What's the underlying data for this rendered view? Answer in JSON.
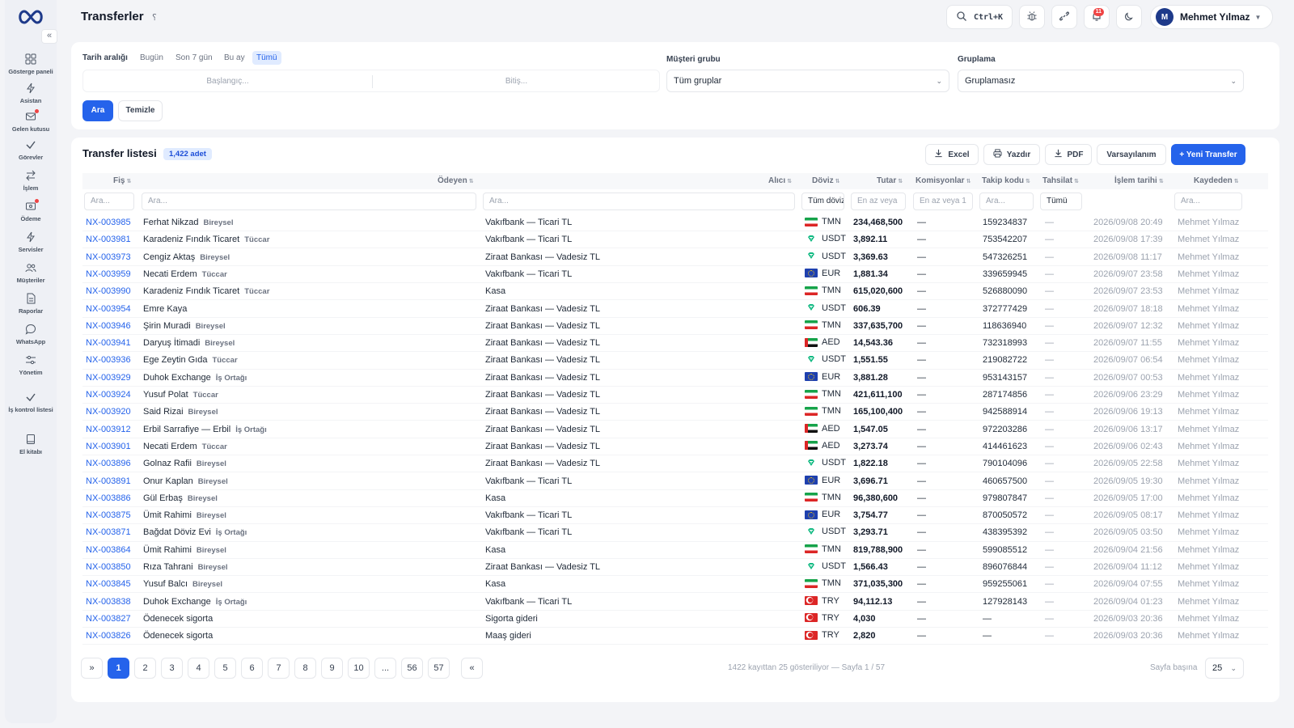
{
  "page": {
    "title": "Transferler"
  },
  "topbar": {
    "search_shortcut": "Ctrl+K",
    "notification_count": "11",
    "user_initial": "M",
    "user_name": "Mehmet Yılmaz"
  },
  "sidebar": {
    "items": [
      {
        "label": "Gösterge paneli"
      },
      {
        "label": "Asistan"
      },
      {
        "label": "Gelen kutusu"
      },
      {
        "label": "Görevler"
      },
      {
        "label": "İşlem"
      },
      {
        "label": "Ödeme"
      },
      {
        "label": "Servisler"
      },
      {
        "label": "Müşteriler"
      },
      {
        "label": "Raporlar"
      },
      {
        "label": "WhatsApp"
      },
      {
        "label": "Yönetim"
      },
      {
        "label": "İş kontrol listesi"
      },
      {
        "label": "El kitabı"
      }
    ]
  },
  "filters": {
    "date_label": "Tarih aralığı",
    "chips": [
      "Bugün",
      "Son 7 gün",
      "Bu ay",
      "Tümü"
    ],
    "start_placeholder": "Başlangıç...",
    "end_placeholder": "Bitiş...",
    "group_label": "Müşteri grubu",
    "group_value": "Tüm gruplar",
    "grouping_label": "Gruplama",
    "grouping_value": "Gruplamasız",
    "search_button": "Ara",
    "clear_button": "Temizle"
  },
  "list": {
    "title": "Transfer listesi",
    "count": "1,422 adet",
    "actions": {
      "excel": "Excel",
      "print": "Yazdır",
      "pdf": "PDF",
      "default": "Varsayılanım",
      "new": "+ Yeni Transfer"
    },
    "columns": [
      "Fiş",
      "Ödeyen",
      "Alıcı",
      "Döviz",
      "Tutar",
      "Komisyonlar",
      "Takip kodu",
      "Tahsilat",
      "İşlem tarihi",
      "Kaydeden"
    ],
    "col_filters": {
      "fis": "Ara...",
      "odeyen": "Ara...",
      "alici": "Ara...",
      "doviz": "Tüm döviz",
      "tutar": "En az veya",
      "komisyon": "En az veya 1",
      "takip": "Ara...",
      "tahsilat": "Tümü",
      "kaydeden": "Ara..."
    },
    "rows": [
      {
        "fis": "NX-003985",
        "payer": "Ferhat Nikzad",
        "tag": "Bireysel",
        "receiver": "Vakıfbank — Ticari TL",
        "cur": "TMN",
        "amount": "234,468,500",
        "comm": "—",
        "code": "159234837",
        "coll": "—",
        "date": "2026/09/08 20:49",
        "by": "Mehmet Yılmaz"
      },
      {
        "fis": "NX-003981",
        "payer": "Karadeniz Fındık Ticaret",
        "tag": "Tüccar",
        "receiver": "Vakıfbank — Ticari TL",
        "cur": "USDT",
        "amount": "3,892.11",
        "comm": "—",
        "code": "753542207",
        "coll": "—",
        "date": "2026/09/08 17:39",
        "by": "Mehmet Yılmaz"
      },
      {
        "fis": "NX-003973",
        "payer": "Cengiz Aktaş",
        "tag": "Bireysel",
        "receiver": "Ziraat Bankası — Vadesiz TL",
        "cur": "USDT",
        "amount": "3,369.63",
        "comm": "—",
        "code": "547326251",
        "coll": "—",
        "date": "2026/09/08 11:17",
        "by": "Mehmet Yılmaz"
      },
      {
        "fis": "NX-003959",
        "payer": "Necati Erdem",
        "tag": "Tüccar",
        "receiver": "Vakıfbank — Ticari TL",
        "cur": "EUR",
        "amount": "1,881.34",
        "comm": "—",
        "code": "339659945",
        "coll": "—",
        "date": "2026/09/07 23:58",
        "by": "Mehmet Yılmaz"
      },
      {
        "fis": "NX-003990",
        "payer": "Karadeniz Fındık Ticaret",
        "tag": "Tüccar",
        "receiver": "Kasa",
        "cur": "TMN",
        "amount": "615,020,600",
        "comm": "—",
        "code": "526880090",
        "coll": "—",
        "date": "2026/09/07 23:53",
        "by": "Mehmet Yılmaz"
      },
      {
        "fis": "NX-003954",
        "payer": "Emre Kaya",
        "tag": "",
        "receiver": "Ziraat Bankası — Vadesiz TL",
        "cur": "USDT",
        "amount": "606.39",
        "comm": "—",
        "code": "372777429",
        "coll": "—",
        "date": "2026/09/07 18:18",
        "by": "Mehmet Yılmaz"
      },
      {
        "fis": "NX-003946",
        "payer": "Şirin Muradi",
        "tag": "Bireysel",
        "receiver": "Ziraat Bankası — Vadesiz TL",
        "cur": "TMN",
        "amount": "337,635,700",
        "comm": "—",
        "code": "118636940",
        "coll": "—",
        "date": "2026/09/07 12:32",
        "by": "Mehmet Yılmaz"
      },
      {
        "fis": "NX-003941",
        "payer": "Daryuş İtimadi",
        "tag": "Bireysel",
        "receiver": "Ziraat Bankası — Vadesiz TL",
        "cur": "AED",
        "amount": "14,543.36",
        "comm": "—",
        "code": "732318993",
        "coll": "—",
        "date": "2026/09/07 11:55",
        "by": "Mehmet Yılmaz"
      },
      {
        "fis": "NX-003936",
        "payer": "Ege Zeytin Gıda",
        "tag": "Tüccar",
        "receiver": "Ziraat Bankası — Vadesiz TL",
        "cur": "USDT",
        "amount": "1,551.55",
        "comm": "—",
        "code": "219082722",
        "coll": "—",
        "date": "2026/09/07 06:54",
        "by": "Mehmet Yılmaz"
      },
      {
        "fis": "NX-003929",
        "payer": "Duhok Exchange",
        "tag": "İş Ortağı",
        "receiver": "Ziraat Bankası — Vadesiz TL",
        "cur": "EUR",
        "amount": "3,881.28",
        "comm": "—",
        "code": "953143157",
        "coll": "—",
        "date": "2026/09/07 00:53",
        "by": "Mehmet Yılmaz"
      },
      {
        "fis": "NX-003924",
        "payer": "Yusuf Polat",
        "tag": "Tüccar",
        "receiver": "Ziraat Bankası — Vadesiz TL",
        "cur": "TMN",
        "amount": "421,611,100",
        "comm": "—",
        "code": "287174856",
        "coll": "—",
        "date": "2026/09/06 23:29",
        "by": "Mehmet Yılmaz"
      },
      {
        "fis": "NX-003920",
        "payer": "Said Rizai",
        "tag": "Bireysel",
        "receiver": "Ziraat Bankası — Vadesiz TL",
        "cur": "TMN",
        "amount": "165,100,400",
        "comm": "—",
        "code": "942588914",
        "coll": "—",
        "date": "2026/09/06 19:13",
        "by": "Mehmet Yılmaz"
      },
      {
        "fis": "NX-003912",
        "payer": "Erbil Sarrafiye — Erbil",
        "tag": "İş Ortağı",
        "receiver": "Ziraat Bankası — Vadesiz TL",
        "cur": "AED",
        "amount": "1,547.05",
        "comm": "—",
        "code": "972203286",
        "coll": "—",
        "date": "2026/09/06 13:17",
        "by": "Mehmet Yılmaz"
      },
      {
        "fis": "NX-003901",
        "payer": "Necati Erdem",
        "tag": "Tüccar",
        "receiver": "Ziraat Bankası — Vadesiz TL",
        "cur": "AED",
        "amount": "3,273.74",
        "comm": "—",
        "code": "414461623",
        "coll": "—",
        "date": "2026/09/06 02:43",
        "by": "Mehmet Yılmaz"
      },
      {
        "fis": "NX-003896",
        "payer": "Golnaz Rafii",
        "tag": "Bireysel",
        "receiver": "Ziraat Bankası — Vadesiz TL",
        "cur": "USDT",
        "amount": "1,822.18",
        "comm": "—",
        "code": "790104096",
        "coll": "—",
        "date": "2026/09/05 22:58",
        "by": "Mehmet Yılmaz"
      },
      {
        "fis": "NX-003891",
        "payer": "Onur Kaplan",
        "tag": "Bireysel",
        "receiver": "Vakıfbank — Ticari TL",
        "cur": "EUR",
        "amount": "3,696.71",
        "comm": "—",
        "code": "460657500",
        "coll": "—",
        "date": "2026/09/05 19:30",
        "by": "Mehmet Yılmaz"
      },
      {
        "fis": "NX-003886",
        "payer": "Gül Erbaş",
        "tag": "Bireysel",
        "receiver": "Kasa",
        "cur": "TMN",
        "amount": "96,380,600",
        "comm": "—",
        "code": "979807847",
        "coll": "—",
        "date": "2026/09/05 17:00",
        "by": "Mehmet Yılmaz"
      },
      {
        "fis": "NX-003875",
        "payer": "Ümit Rahimi",
        "tag": "Bireysel",
        "receiver": "Vakıfbank — Ticari TL",
        "cur": "EUR",
        "amount": "3,754.77",
        "comm": "—",
        "code": "870050572",
        "coll": "—",
        "date": "2026/09/05 08:17",
        "by": "Mehmet Yılmaz"
      },
      {
        "fis": "NX-003871",
        "payer": "Bağdat Döviz Evi",
        "tag": "İş Ortağı",
        "receiver": "Vakıfbank — Ticari TL",
        "cur": "USDT",
        "amount": "3,293.71",
        "comm": "—",
        "code": "438395392",
        "coll": "—",
        "date": "2026/09/05 03:50",
        "by": "Mehmet Yılmaz"
      },
      {
        "fis": "NX-003864",
        "payer": "Ümit Rahimi",
        "tag": "Bireysel",
        "receiver": "Kasa",
        "cur": "TMN",
        "amount": "819,788,900",
        "comm": "—",
        "code": "599085512",
        "coll": "—",
        "date": "2026/09/04 21:56",
        "by": "Mehmet Yılmaz"
      },
      {
        "fis": "NX-003850",
        "payer": "Rıza Tahrani",
        "tag": "Bireysel",
        "receiver": "Ziraat Bankası — Vadesiz TL",
        "cur": "USDT",
        "amount": "1,566.43",
        "comm": "—",
        "code": "896076844",
        "coll": "—",
        "date": "2026/09/04 11:12",
        "by": "Mehmet Yılmaz"
      },
      {
        "fis": "NX-003845",
        "payer": "Yusuf Balcı",
        "tag": "Bireysel",
        "receiver": "Kasa",
        "cur": "TMN",
        "amount": "371,035,300",
        "comm": "—",
        "code": "959255061",
        "coll": "—",
        "date": "2026/09/04 07:55",
        "by": "Mehmet Yılmaz"
      },
      {
        "fis": "NX-003838",
        "payer": "Duhok Exchange",
        "tag": "İş Ortağı",
        "receiver": "Vakıfbank — Ticari TL",
        "cur": "TRY",
        "amount": "94,112.13",
        "comm": "—",
        "code": "127928143",
        "coll": "—",
        "date": "2026/09/04 01:23",
        "by": "Mehmet Yılmaz"
      },
      {
        "fis": "NX-003827",
        "payer": "Ödenecek sigorta",
        "tag": "",
        "receiver": "Sigorta gideri",
        "cur": "TRY",
        "amount": "4,030",
        "comm": "—",
        "code": "—",
        "coll": "—",
        "date": "2026/09/03 20:36",
        "by": "Mehmet Yılmaz"
      },
      {
        "fis": "NX-003826",
        "payer": "Ödenecek sigorta",
        "tag": "",
        "receiver": "Maaş gideri",
        "cur": "TRY",
        "amount": "2,820",
        "comm": "—",
        "code": "—",
        "coll": "—",
        "date": "2026/09/03 20:36",
        "by": "Mehmet Yılmaz"
      }
    ]
  },
  "pagination": {
    "first": "»",
    "pages": [
      "1",
      "2",
      "3",
      "4",
      "5",
      "6",
      "7",
      "8",
      "9",
      "10",
      "...",
      "56",
      "57"
    ],
    "last": "«",
    "info": "1422 kayıttan 25 gösteriliyor — Sayfa 1 / 57",
    "per_page_label": "Sayfa başına",
    "per_page_value": "25"
  }
}
